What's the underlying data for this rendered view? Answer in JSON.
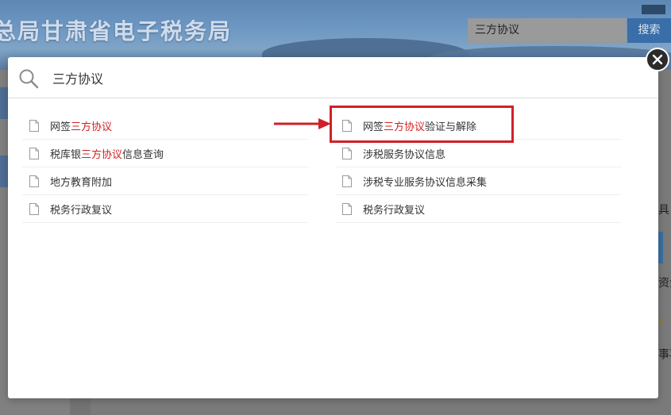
{
  "background": {
    "site_title": "总局甘肃省电子税务局",
    "search_value": "三方协议",
    "search_button": "搜索",
    "right_fragments": [
      "具",
      "资金",
      "事项"
    ]
  },
  "modal": {
    "search_query": "三方协议",
    "results_left": [
      {
        "prefix": "网签",
        "highlight": "三方协议",
        "suffix": ""
      },
      {
        "prefix": "税库银",
        "highlight": "三方协议",
        "suffix": "信息查询"
      },
      {
        "prefix": "地方教育附加",
        "highlight": "",
        "suffix": ""
      },
      {
        "prefix": "税务行政复议",
        "highlight": "",
        "suffix": ""
      }
    ],
    "results_right": [
      {
        "prefix": "网签",
        "highlight": "三方协议",
        "suffix": "验证与解除"
      },
      {
        "prefix": "涉税服务协议信息",
        "highlight": "",
        "suffix": ""
      },
      {
        "prefix": "涉税专业服务协议信息采集",
        "highlight": "",
        "suffix": ""
      },
      {
        "prefix": "税务行政复议",
        "highlight": "",
        "suffix": ""
      }
    ]
  },
  "colors": {
    "highlight_text": "#d32020",
    "annotation_red": "#d0202a",
    "header_blue": "#6f9ac4",
    "search_button_blue": "#3a6ea8"
  },
  "icons": [
    "search-icon",
    "document-icon",
    "close-icon",
    "arrow-icon"
  ]
}
